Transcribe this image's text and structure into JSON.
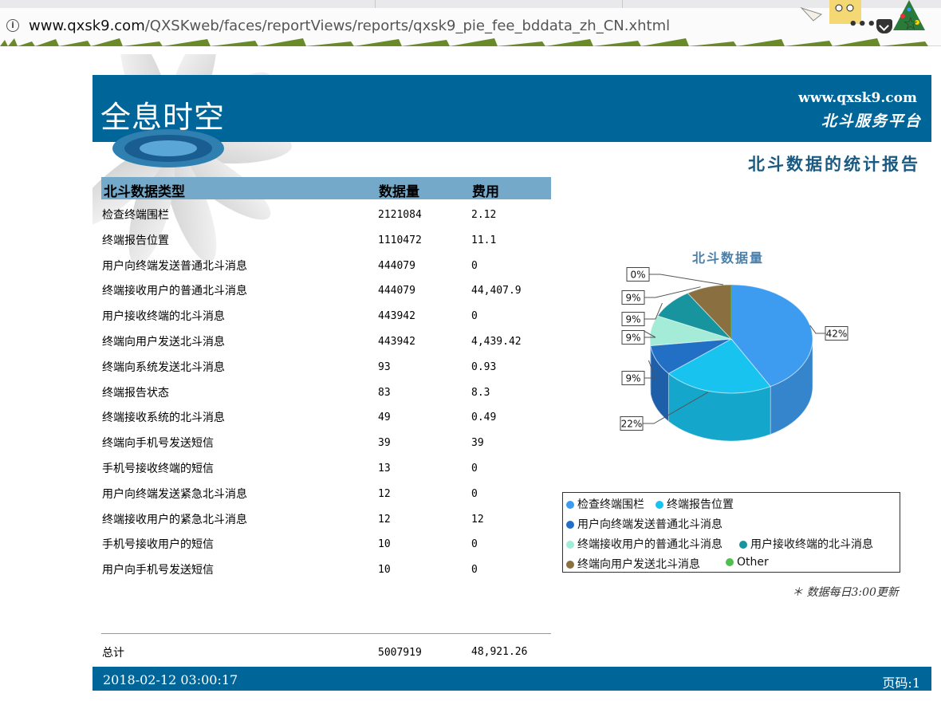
{
  "browser": {
    "url_host": "www.qxsk9.com",
    "url_path": "/QXSKweb/faces/reportViews/reports/qxsk9_pie_fee_bddata_zh_CN.xhtml",
    "menu_label": "•••"
  },
  "header": {
    "logo": "全息时空",
    "site_url": "www.qxsk9.com",
    "platform": "北斗服务平台",
    "report_title": "北斗数据的统计报告"
  },
  "table": {
    "columns": [
      "北斗数据类型",
      "数据量",
      "费用"
    ],
    "rows": [
      {
        "name": "检查终端围栏",
        "amount": "2121084",
        "fee": "2.12"
      },
      {
        "name": "终端报告位置",
        "amount": "1110472",
        "fee": "11.1"
      },
      {
        "name": "用户向终端发送普通北斗消息",
        "amount": "444079",
        "fee": "0"
      },
      {
        "name": "终端接收用户的普通北斗消息",
        "amount": "444079",
        "fee": "44,407.9"
      },
      {
        "name": "用户接收终端的北斗消息",
        "amount": "443942",
        "fee": "0"
      },
      {
        "name": "终端向用户发送北斗消息",
        "amount": "443942",
        "fee": "4,439.42"
      },
      {
        "name": "终端向系统发送北斗消息",
        "amount": "93",
        "fee": "0.93"
      },
      {
        "name": "终端报告状态",
        "amount": "83",
        "fee": "8.3"
      },
      {
        "name": "终端接收系统的北斗消息",
        "amount": "49",
        "fee": "0.49"
      },
      {
        "name": "终端向手机号发送短信",
        "amount": "39",
        "fee": "39"
      },
      {
        "name": "手机号接收终端的短信",
        "amount": "13",
        "fee": "0"
      },
      {
        "name": "用户向终端发送紧急北斗消息",
        "amount": "12",
        "fee": "0"
      },
      {
        "name": "终端接收用户的紧急北斗消息",
        "amount": "12",
        "fee": "12"
      },
      {
        "name": "手机号接收用户的短信",
        "amount": "10",
        "fee": "0"
      },
      {
        "name": "用户向手机号发送短信",
        "amount": "10",
        "fee": "0"
      }
    ],
    "total": {
      "name": "总计",
      "amount": "5007919",
      "fee": "48,921.26"
    }
  },
  "footer": {
    "date": "2018-02-12 03:00:17",
    "page": "页码:1"
  },
  "note": "＊ 数据每日3:00更新",
  "chart_data": {
    "type": "pie",
    "title": "北斗数据量",
    "series": [
      {
        "name": "检查终端围栏",
        "percent_label": "42%",
        "value": 42,
        "color": "#3d9cf0"
      },
      {
        "name": "终端报告位置",
        "percent_label": "22%",
        "value": 22,
        "color": "#19c3f0"
      },
      {
        "name": "用户向终端发送普通北斗消息",
        "percent_label": "9%",
        "value": 9,
        "color": "#2270c6"
      },
      {
        "name": "终端接收用户的普通北斗消息",
        "percent_label": "9%",
        "value": 9,
        "color": "#a4ecd8"
      },
      {
        "name": "用户接收终端的北斗消息",
        "percent_label": "9%",
        "value": 9,
        "color": "#17949e"
      },
      {
        "name": "终端向用户发送北斗消息",
        "percent_label": "9%",
        "value": 9,
        "color": "#8a7040"
      },
      {
        "name": "Other",
        "percent_label": "0%",
        "value": 0,
        "color": "#4fbf4f"
      }
    ]
  }
}
